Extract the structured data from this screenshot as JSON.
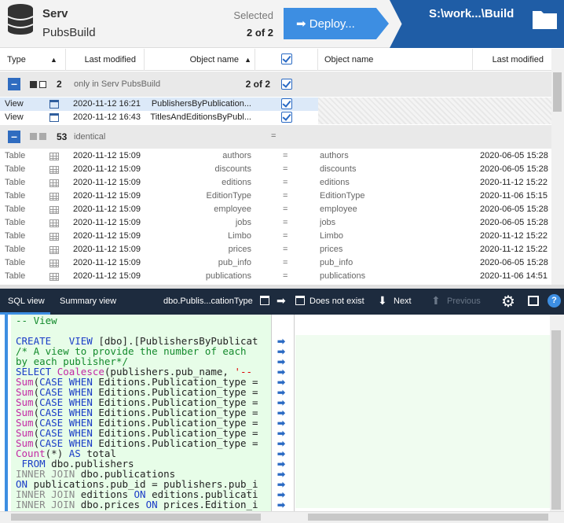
{
  "header": {
    "source_server": "Serv",
    "source_db": "PubsBuild",
    "selected_label": "Selected",
    "selected_count": "2 of 2",
    "deploy_label": "➡ Deploy...",
    "target_path": "S:\\work...\\Build"
  },
  "columns": {
    "type": "Type",
    "last_modified_left": "Last modified",
    "object_name_left": "Object name",
    "object_name_right": "Object name",
    "last_modified_right": "Last modified"
  },
  "group1": {
    "count": "2",
    "label": "only in Serv PubsBuild",
    "selected": "2 of 2",
    "rows": [
      {
        "type": "View",
        "modified": "2020-11-12 16:21",
        "name": "PublishersByPublication..."
      },
      {
        "type": "View",
        "modified": "2020-11-12 16:43",
        "name": "TitlesAndEditionsByPubl..."
      }
    ]
  },
  "group2": {
    "count": "53",
    "label": "identical",
    "eq": "=",
    "rows": [
      {
        "type": "Table",
        "modified": "2020-11-12 15:09",
        "name": "authors",
        "eq": "=",
        "rname": "authors",
        "rmodified": "2020-06-05 15:28"
      },
      {
        "type": "Table",
        "modified": "2020-11-12 15:09",
        "name": "discounts",
        "eq": "=",
        "rname": "discounts",
        "rmodified": "2020-06-05 15:28"
      },
      {
        "type": "Table",
        "modified": "2020-11-12 15:09",
        "name": "editions",
        "eq": "=",
        "rname": "editions",
        "rmodified": "2020-11-12 15:22"
      },
      {
        "type": "Table",
        "modified": "2020-11-12 15:09",
        "name": "EditionType",
        "eq": "=",
        "rname": "EditionType",
        "rmodified": "2020-11-06 15:15"
      },
      {
        "type": "Table",
        "modified": "2020-11-12 15:09",
        "name": "employee",
        "eq": "=",
        "rname": "employee",
        "rmodified": "2020-06-05 15:28"
      },
      {
        "type": "Table",
        "modified": "2020-11-12 15:09",
        "name": "jobs",
        "eq": "=",
        "rname": "jobs",
        "rmodified": "2020-06-05 15:28"
      },
      {
        "type": "Table",
        "modified": "2020-11-12 15:09",
        "name": "Limbo",
        "eq": "=",
        "rname": "Limbo",
        "rmodified": "2020-11-12 15:22"
      },
      {
        "type": "Table",
        "modified": "2020-11-12 15:09",
        "name": "prices",
        "eq": "=",
        "rname": "prices",
        "rmodified": "2020-11-12 15:22"
      },
      {
        "type": "Table",
        "modified": "2020-11-12 15:09",
        "name": "pub_info",
        "eq": "=",
        "rname": "pub_info",
        "rmodified": "2020-06-05 15:28"
      },
      {
        "type": "Table",
        "modified": "2020-11-12 15:09",
        "name": "publications",
        "eq": "=",
        "rname": "publications",
        "rmodified": "2020-11-06 14:51"
      }
    ]
  },
  "bottom": {
    "tab_sql": "SQL view",
    "tab_summary": "Summary view",
    "object": "dbo.Publis...cationType",
    "status": "Does not exist",
    "next": "Next",
    "previous": "Previous"
  },
  "code_lines": [
    "-- View",
    "",
    "CREATE   VIEW [dbo].[PublishersByPublicat",
    "/* A view to provide the number of each",
    "by each publisher*/",
    "SELECT Coalesce(publishers.pub_name, '--",
    "Sum(CASE WHEN Editions.Publication_type =",
    "Sum(CASE WHEN Editions.Publication_type =",
    "Sum(CASE WHEN Editions.Publication_type =",
    "Sum(CASE WHEN Editions.Publication_type =",
    "Sum(CASE WHEN Editions.Publication_type =",
    "Sum(CASE WHEN Editions.Publication_type =",
    "Sum(CASE WHEN Editions.Publication_type =",
    "Count(*) AS total",
    " FROM dbo.publishers",
    "INNER JOIN dbo.publications",
    "ON publications.pub_id = publishers.pub_i",
    "INNER JOIN editions ON editions.publicati",
    "INNER JOIN dbo.prices ON prices.Edition_i"
  ],
  "colors": {
    "accent": "#3d8ee2",
    "target": "#1f5da6",
    "tabbar": "#1d2b3e",
    "code_bg": "#e7fde8"
  }
}
